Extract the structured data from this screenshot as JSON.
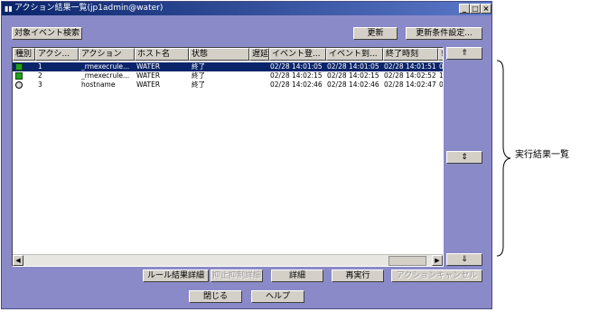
{
  "window": {
    "title": "アクション結果一覧(jp1admin@water)",
    "controls": {
      "minimize": "_",
      "maximize": "□",
      "close": "×"
    }
  },
  "toolbar": {
    "search_label": "対象イベント検索",
    "refresh_label": "更新",
    "refresh_settings_label": "更新条件設定..."
  },
  "table": {
    "columns": [
      "種別",
      "アクシ...",
      "アクション",
      "ホスト名",
      "状態",
      "遅延",
      "イベント登...",
      "イベント到...",
      "終了時刻",
      "!"
    ],
    "rows": [
      {
        "icon": "action-icon",
        "type": "",
        "id": "1",
        "action": "_rmexecrule...",
        "host": "WATER",
        "status": "終了",
        "delay": "",
        "registered": "02/28 14:01:05",
        "arrived": "02/28 14:01:05",
        "end": "02/28 14:01:51",
        "extra": "0"
      },
      {
        "icon": "action-icon",
        "type": "",
        "id": "2",
        "action": "_rmexecrule...",
        "host": "WATER",
        "status": "終了",
        "delay": "",
        "registered": "02/28 14:02:15",
        "arrived": "02/28 14:02:15",
        "end": "02/28 14:02:52",
        "extra": "1"
      },
      {
        "icon": "command-icon",
        "type": "",
        "id": "3",
        "action": "hostname",
        "host": "WATER",
        "status": "終了",
        "delay": "",
        "registered": "02/28 14:02:46",
        "arrived": "02/28 14:02:46",
        "end": "02/28 14:02:47",
        "extra": "0"
      }
    ]
  },
  "side_buttons": {
    "top": "⇑",
    "middle": "⇕",
    "bottom": "⇓"
  },
  "action_buttons": {
    "rule_detail": "ルール結果詳細",
    "suppress_detail": "抑止抑制詳細",
    "detail": "詳細",
    "rerun": "再実行",
    "cancel_action": "アクションキャンセル"
  },
  "footer": {
    "close": "閉じる",
    "help": "ヘルプ"
  },
  "annotation": {
    "label": "実行結果一覧"
  },
  "colors": {
    "window_bg": "#8a8ac8",
    "title_bg": "#0a246a",
    "selection": "#0a246a",
    "button_face": "#d4d0c8"
  }
}
